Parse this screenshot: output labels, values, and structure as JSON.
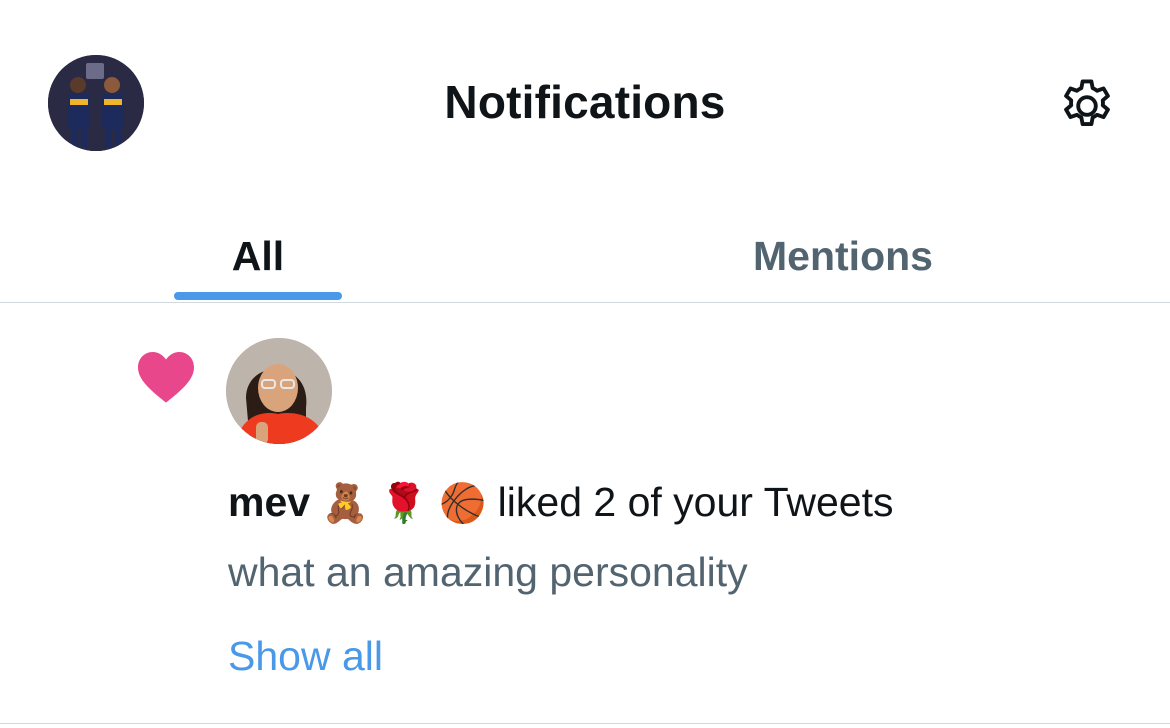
{
  "header": {
    "title": "Notifications",
    "avatar_icon": "profile-avatar",
    "settings_icon": "gear-icon"
  },
  "tabs": [
    {
      "label": "All",
      "active": true
    },
    {
      "label": "Mentions",
      "active": false
    }
  ],
  "notification": {
    "icon": "heart-icon",
    "icon_color": "#e0245e",
    "username": "mev",
    "emojis": [
      "🧸",
      "🌹",
      "🏀"
    ],
    "action": "liked 2 of your Tweets",
    "tweet_text": "what an amazing personality",
    "show_all_label": "Show all"
  },
  "colors": {
    "accent": "#4a99e9",
    "text_primary": "#0f1419",
    "text_secondary": "#536471",
    "divider": "#cfd9de"
  }
}
